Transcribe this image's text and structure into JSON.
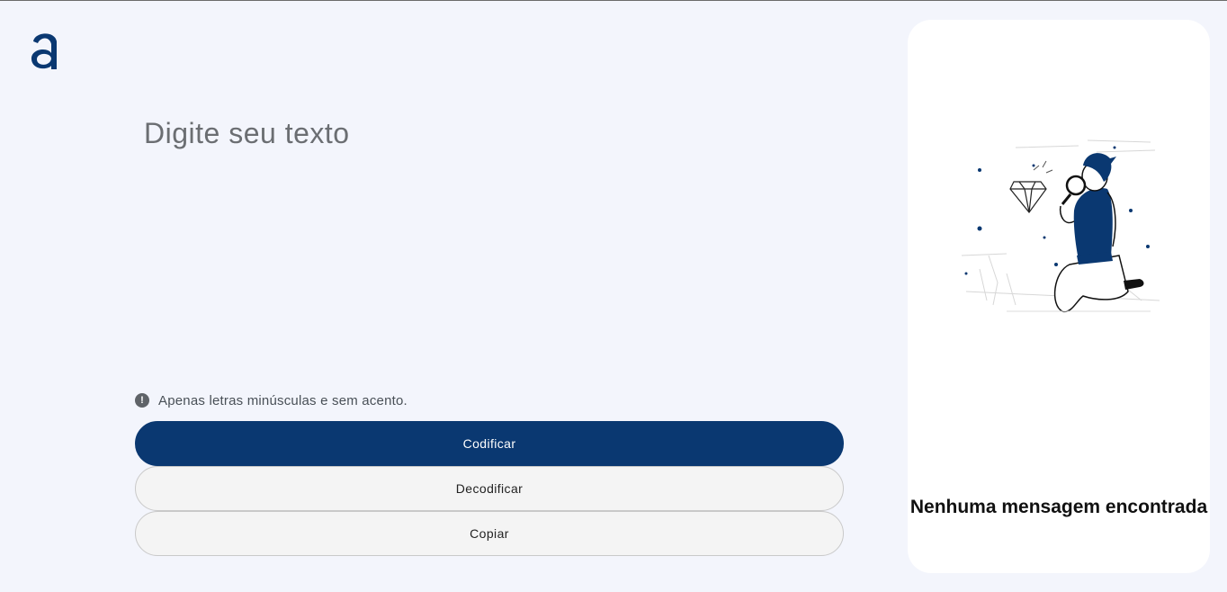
{
  "brand": {
    "logo_letter": "a",
    "accent_color": "#0A3871",
    "background_color": "#F3F5FC"
  },
  "editor": {
    "placeholder": "Digite seu texto",
    "value": ""
  },
  "hint": {
    "icon": "exclamation-icon",
    "text": "Apenas letras minúsculas e sem acento."
  },
  "actions": {
    "encrypt_label": "Codificar",
    "decrypt_label": "Decodificar",
    "copy_label": "Copiar"
  },
  "output": {
    "empty_title": "Nenhuma mensagem encontrada",
    "illustration": "person-with-magnifier-illustration"
  }
}
